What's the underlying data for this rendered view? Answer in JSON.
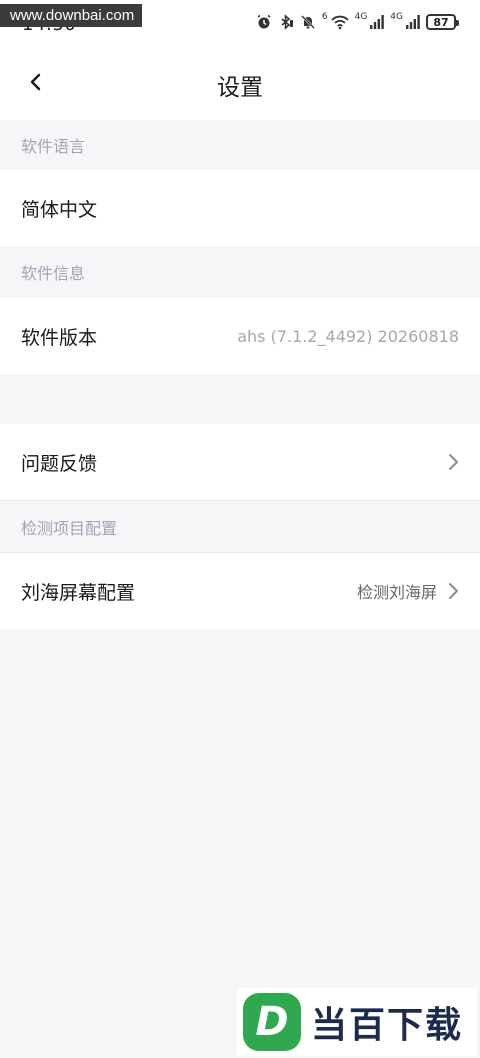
{
  "status_bar": {
    "time": "14:50",
    "network_label_1": "4G",
    "network_label_2": "4G",
    "wifi_label": "6",
    "battery_level": "87",
    "icons": [
      "alarm-icon",
      "bluetooth-icon",
      "mute-icon",
      "wifi-icon",
      "signal-icon",
      "battery-icon"
    ]
  },
  "watermark": "www.downbai.com",
  "header": {
    "title": "设置",
    "back_icon": "chevron-left-icon"
  },
  "sections": {
    "language_header": "软件语言",
    "language_value": "简体中文",
    "info_header": "软件信息",
    "version_label": "软件版本",
    "version_value": "ahs (7.1.2_4492) 20260818",
    "feedback_label": "问题反馈",
    "detection_header": "检测项目配置",
    "notch_label": "刘海屏幕配置",
    "notch_value": "检测刘海屏"
  },
  "logo": {
    "letter": "D",
    "text": "当百下载",
    "brand_color": "#2fa84f"
  }
}
